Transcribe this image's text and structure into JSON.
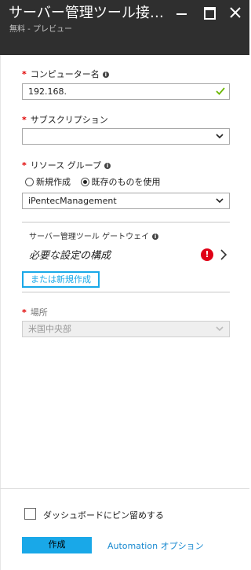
{
  "header": {
    "title": "サーバー管理ツール接…",
    "subtitle": "無料 - プレビュー"
  },
  "form": {
    "computer_name": {
      "required_mark": "*",
      "label": "コンピューター名",
      "value": "192.168."
    },
    "subscription": {
      "required_mark": "*",
      "label": "サブスクリプション",
      "value": ""
    },
    "resource_group": {
      "required_mark": "*",
      "label": "リソース グループ",
      "options": [
        {
          "label": "新規作成",
          "selected": false
        },
        {
          "label": "既存のものを使用",
          "selected": true
        }
      ],
      "value": "iPentecManagement"
    },
    "gateway": {
      "label": "サーバー管理ツール ゲートウェイ",
      "value": "必要な設定の構成",
      "error_icon": "!",
      "new_button": "または新規作成"
    },
    "location": {
      "required_mark": "*",
      "label": "場所",
      "value": "米国中央部"
    }
  },
  "footer": {
    "pin_label": "ダッシュボードにピン留めする",
    "pin_checked": false,
    "create_button": "作成",
    "automation_link": "Automation オプション"
  },
  "colors": {
    "accent": "#19a8e8",
    "header": "#2f2f2f",
    "error": "#e00016",
    "required": "#e00000"
  }
}
